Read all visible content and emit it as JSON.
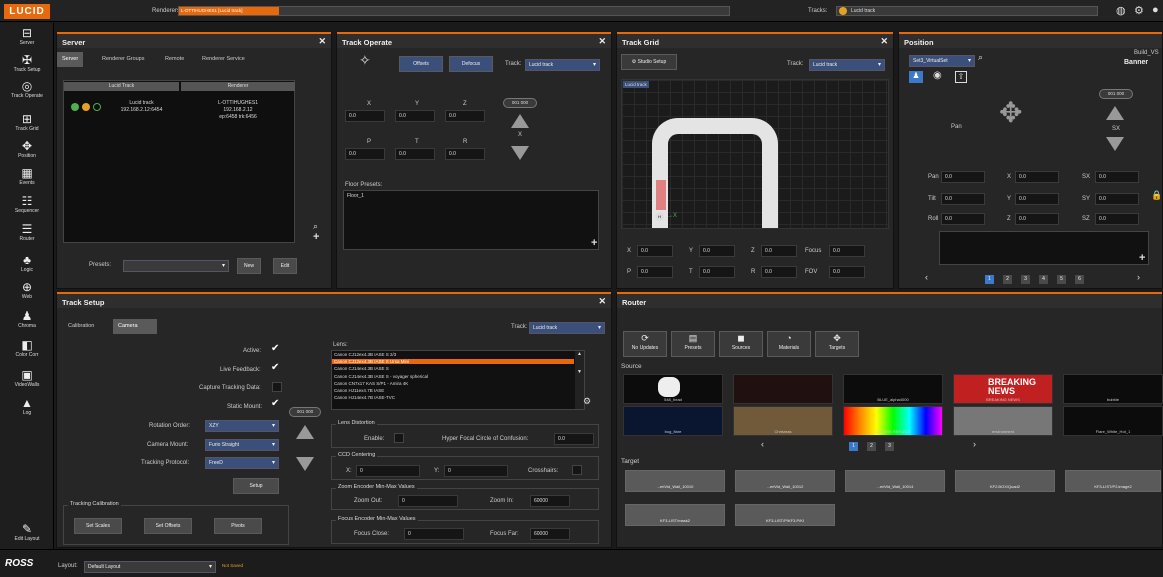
{
  "app": {
    "logo": "LUCID",
    "renderers_label": "Renderers:",
    "renderers_value": "L-OTTIHUGHES1 [Lucid track]",
    "tracks_label": "Tracks:",
    "tracks_value": "Lucid track"
  },
  "sidebar": {
    "items": [
      {
        "label": "Server",
        "icon": "server-icon"
      },
      {
        "label": "Track Setup",
        "icon": "tools-icon"
      },
      {
        "label": "Track Operate",
        "icon": "target-icon"
      },
      {
        "label": "Track Grid",
        "icon": "grid-icon"
      },
      {
        "label": "Position",
        "icon": "move-icon"
      },
      {
        "label": "Events",
        "icon": "calendar-icon"
      },
      {
        "label": "Sequencer",
        "icon": "sequencer-icon"
      },
      {
        "label": "Router",
        "icon": "router-icon"
      },
      {
        "label": "Logic",
        "icon": "logic-icon"
      },
      {
        "label": "Web",
        "icon": "globe-icon"
      },
      {
        "label": "Chroma",
        "icon": "person-icon"
      },
      {
        "label": "Color Corr",
        "icon": "color-icon"
      },
      {
        "label": "VideoWalls",
        "icon": "videowall-icon"
      },
      {
        "label": "Log",
        "icon": "warning-icon"
      }
    ],
    "edit_layout": "Edit Layout"
  },
  "server": {
    "title": "Server",
    "tabs": [
      "Server",
      "Renderer Groups",
      "Remote",
      "Renderer Service"
    ],
    "col1": "Lucid Track",
    "col2": "Renderer",
    "track_name": "Lucid track",
    "track_ip": "192.168.2.12:6454",
    "renderer_name": "L-OTTIHUGHES1",
    "renderer_ip": "192.168.2.12",
    "renderer_port": "ep:6458 trk:6456",
    "presets_label": "Presets:",
    "new_btn": "New",
    "edit_btn": "Edit"
  },
  "track_operate": {
    "title": "Track Operate",
    "offsets_btn": "Offsets",
    "defocus_btn": "Defocus",
    "track_label": "Track:",
    "track_value": "Lucid track",
    "x": "X",
    "y": "Y",
    "z": "Z",
    "p": "P",
    "t": "T",
    "r": "R",
    "vx": "0.0",
    "vy": "0.0",
    "vz": "0.0",
    "vp": "0.0",
    "vt": "0.0",
    "vr": "0.0",
    "pill": "001 000",
    "floor_label": "Floor Presets:",
    "floor_value": "Floor_1"
  },
  "track_grid": {
    "title": "Track Grid",
    "studio_btn": "Studio Setup",
    "track_label": "Track:",
    "track_value": "Lucid track",
    "canvas_label": "Lucid track",
    "fields": [
      {
        "l": "X",
        "v": "0.0"
      },
      {
        "l": "Y",
        "v": "0.0"
      },
      {
        "l": "Z",
        "v": "0.0"
      },
      {
        "l": "Focus",
        "v": "0.0"
      },
      {
        "l": "P",
        "v": "0.0"
      },
      {
        "l": "T",
        "v": "0.0"
      },
      {
        "l": "R",
        "v": "0.0"
      },
      {
        "l": "FOV",
        "v": "0.0"
      }
    ]
  },
  "position": {
    "title": "Position",
    "set_value": "Set3_VirtualSet",
    "build": "Build_VS",
    "banner": "Banner",
    "pill": "001 000",
    "pan_lbl": "Pan",
    "sx_lbl": "SX",
    "fields": [
      {
        "l": "Pan",
        "v": "0.0"
      },
      {
        "l": "X",
        "v": "0.0"
      },
      {
        "l": "SX",
        "v": "0.0"
      },
      {
        "l": "Tilt",
        "v": "0.0"
      },
      {
        "l": "Y",
        "v": "0.0"
      },
      {
        "l": "SY",
        "v": "0.0"
      },
      {
        "l": "Roll",
        "v": "0.0"
      },
      {
        "l": "Z",
        "v": "0.0"
      },
      {
        "l": "SZ",
        "v": "0.0"
      }
    ],
    "pages": [
      "1",
      "2",
      "3",
      "4",
      "5",
      "6"
    ]
  },
  "track_setup": {
    "title": "Track Setup",
    "tabs": [
      "Calibration",
      "Camera"
    ],
    "track_label": "Track:",
    "track_value": "Lucid track",
    "active": "Active:",
    "live_feedback": "Live Feedback:",
    "capture": "Capture Tracking Data:",
    "static_mount": "Static Mount:",
    "rotation_order": "Rotation Order:",
    "rotation_value": "XZY",
    "camera_mount": "Camera Mount:",
    "camera_value": "Furio Straight",
    "protocol": "Tracking Protocol:",
    "protocol_value": "FreeD",
    "setup_btn": "Setup",
    "pill": "001 000",
    "calib_title": "Tracking Calibration",
    "set_scales": "Set Scales",
    "set_offsets": "Set Offsets",
    "pivots": "Pivots",
    "lens_label": "Lens:",
    "lenses": [
      "Canon CJ12ex4.3B IASE S 2/3",
      "Canon CJ12ex4.3B IASE S Ursa Mini",
      "Canon CJ14ex4.3B IASE S",
      "Canon CJ14ex4.3B IASE S - voyager spherical",
      "Canon CN7x17 KAS S/P1 - Amira 4K",
      "Canon HJ11ex4.7B IASE",
      "Canon HJ14ex4.7B IASE-TVC"
    ],
    "lens_distortion": "Lens Distortion",
    "enable": "Enable:",
    "hyper": "Hyper Focal Circle of Confusion:",
    "hyper_value": "0.0",
    "ccd": "CCD Centering",
    "ccd_x": "X:",
    "ccd_xv": "0",
    "ccd_y": "Y:",
    "ccd_yv": "0",
    "crosshairs": "Crosshairs:",
    "zoom_title": "Zoom Encoder Min-Max Values",
    "zoom_out": "Zoom Out:",
    "zoom_out_v": "0",
    "zoom_in": "Zoom In:",
    "zoom_in_v": "60000",
    "focus_title": "Focus Encoder Min-Max Values",
    "focus_close": "Focus Close:",
    "focus_close_v": "0",
    "focus_far": "Focus Far:",
    "focus_far_v": "60000"
  },
  "router": {
    "title": "Router",
    "tabs": [
      "No Updates",
      "Presets",
      "Sources",
      "Materials",
      "Targets"
    ],
    "source_label": "Source",
    "sources": [
      "548_head",
      "",
      "BLUE_alpha4000",
      "BREAKING NEWS",
      "bubble",
      "bug_flare",
      "Chrismas",
      "COLORS REFLECT",
      "environment",
      "Flare_White_Hot_1"
    ],
    "pages": [
      "1",
      "2",
      "3"
    ],
    "target_label": "Target",
    "targets": [
      "...eriVid_Wall_10010",
      "...eriVid_Wall_10012",
      "...eriVid_Wall_10014",
      "KF2.BGX/Quad2",
      "KF3-LIST/P2.image2",
      "KF3-LIST/mask2",
      "KF3-LIST/P/KF3.P/KI",
      ""
    ]
  },
  "status": {
    "ross": "ROSS",
    "layout_label": "Layout:",
    "layout_value": "Default Layout",
    "not_saved": "Not Saved"
  }
}
